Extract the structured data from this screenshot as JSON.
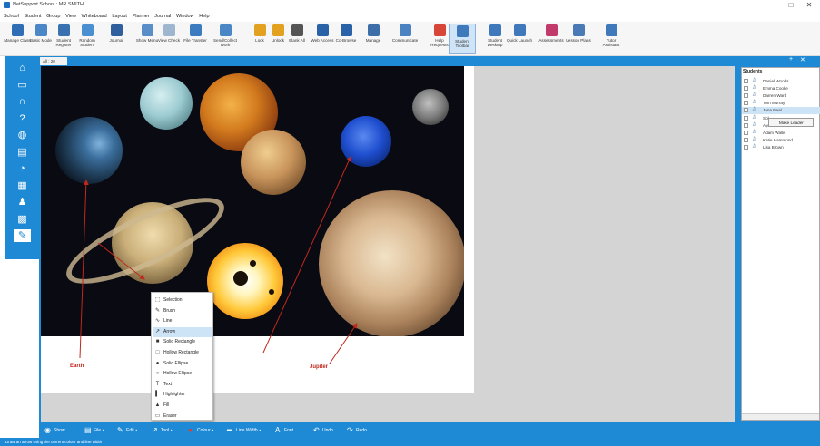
{
  "window": {
    "title": "NetSupport School : MR SMITH",
    "minimize": "−",
    "maximize": "□",
    "close": "✕"
  },
  "menu": [
    "School",
    "Student",
    "Group",
    "View",
    "Whiteboard",
    "Layout",
    "Planner",
    "Journal",
    "Window",
    "Help"
  ],
  "ribbon": [
    {
      "label": "Manage Class",
      "icon": "manage-class-icon",
      "color": "#2f6eb5"
    },
    {
      "label": "Basic Mode",
      "icon": "basic-mode-icon",
      "color": "#4b86c6"
    },
    {
      "label": "Student Register",
      "icon": "register-icon",
      "color": "#3a72b0"
    },
    {
      "label": "Random Student",
      "icon": "random-icon",
      "color": "#4a8fd0"
    },
    {
      "label": "Journal",
      "icon": "journal-icon",
      "color": "#2f5f9c"
    },
    {
      "label": "Show Menu",
      "icon": "show-icon",
      "color": "#5a8ec8"
    },
    {
      "label": "View Check",
      "icon": "view-icon",
      "color": "#9fb6cf"
    },
    {
      "label": "File Transfer",
      "icon": "file-transfer-icon",
      "color": "#3d7bbf"
    },
    {
      "label": "Send/Collect Work",
      "icon": "send-collect-icon",
      "color": "#4b86c6"
    },
    {
      "label": "Lock",
      "icon": "lock-icon",
      "color": "#e2a11e"
    },
    {
      "label": "Unlock",
      "icon": "unlock-icon",
      "color": "#e2a11e"
    },
    {
      "label": "Blank All",
      "icon": "blank-icon",
      "color": "#555555"
    },
    {
      "label": "Web Access",
      "icon": "web-icon",
      "color": "#2a62a8"
    },
    {
      "label": "Co-Browse",
      "icon": "co-browse-icon",
      "color": "#2a62a8"
    },
    {
      "label": "Manage",
      "icon": "manage-icon",
      "color": "#3d6ea8"
    },
    {
      "label": "Communicate",
      "icon": "communicate-icon",
      "color": "#4a82c2"
    },
    {
      "label": "Help Requests",
      "icon": "help-requests-icon",
      "color": "#d8463a"
    },
    {
      "label": "Student Toolbar",
      "icon": "student-toolbar-icon",
      "color": "#3f78bb"
    },
    {
      "label": "Student Desktop",
      "icon": "student-desktop-icon",
      "color": "#3f78bb"
    },
    {
      "label": "Quick Launch",
      "icon": "quick-launch-icon",
      "color": "#3f78bb"
    },
    {
      "label": "Assessments",
      "icon": "assessments-icon",
      "color": "#c23a6a"
    },
    {
      "label": "Lesson Plans",
      "icon": "lesson-plans-icon",
      "color": "#4a7ab5"
    },
    {
      "label": "Tutor Assistant",
      "icon": "tutor-assistant-icon",
      "color": "#3f78bb"
    }
  ],
  "leftnav": [
    "home-icon",
    "monitor-icon",
    "headphones-icon",
    "question-icon",
    "globe-icon",
    "book-icon",
    "pie-icon",
    "printer-icon",
    "users-icon",
    "grid-icon",
    "whiteboard-icon"
  ],
  "tab": {
    "label": "All : 20"
  },
  "annotations": {
    "earth": "Earth",
    "jupiter": "Jupiter"
  },
  "tools_menu": [
    {
      "label": "Selection",
      "glyph": "⬚"
    },
    {
      "label": "Brush",
      "glyph": "✎"
    },
    {
      "label": "Line",
      "glyph": "∿"
    },
    {
      "label": "Arrow",
      "glyph": "↗"
    },
    {
      "label": "Solid Rectangle",
      "glyph": "■"
    },
    {
      "label": "Hollow Rectangle",
      "glyph": "□"
    },
    {
      "label": "Solid Ellipse",
      "glyph": "●"
    },
    {
      "label": "Hollow Ellipse",
      "glyph": "○"
    },
    {
      "label": "Text",
      "glyph": "T"
    },
    {
      "label": "Highlighter",
      "glyph": "▍"
    },
    {
      "label": "Fill",
      "glyph": "▲"
    },
    {
      "label": "Eraser",
      "glyph": "▭"
    }
  ],
  "students_header": "Students",
  "students": [
    "Daniel Woods",
    "Emma Cooke",
    "Darren Ward",
    "Tom Murray",
    "Jana Neal",
    "Sol...",
    "Ayo... Patrick",
    "Adam Wallis",
    "Katie Hammond",
    "Lisa Brown"
  ],
  "student_tip": "Make Leader",
  "bottom_tools": [
    {
      "label": "Show",
      "glyph": "◉"
    },
    {
      "label": "File ▴",
      "glyph": "▤"
    },
    {
      "label": "Edit ▴",
      "glyph": "✎"
    },
    {
      "label": "Tool ▴",
      "glyph": "↗"
    },
    {
      "label": "Colour ▴",
      "glyph": "●"
    },
    {
      "label": "Line Width ▴",
      "glyph": "━"
    },
    {
      "label": "Font...",
      "glyph": "A"
    },
    {
      "label": "Undo",
      "glyph": "↶"
    },
    {
      "label": "Redo",
      "glyph": "↷"
    }
  ],
  "status": "Draw an arrow using the current colour and line width",
  "colors": {
    "accent": "#1e8ad6",
    "annotation": "#c0281d"
  }
}
